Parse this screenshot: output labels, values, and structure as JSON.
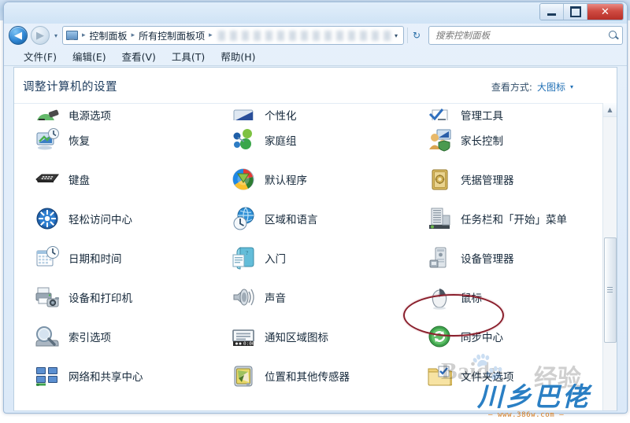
{
  "window": {
    "titlebar_buttons": [
      {
        "name": "minimize",
        "glyph": "—"
      },
      {
        "name": "maximize",
        "glyph": "□"
      },
      {
        "name": "close",
        "glyph": "✕"
      }
    ]
  },
  "address": {
    "back_glyph": "◀",
    "forward_glyph": "▶",
    "history_caret": "▾",
    "crumb_icon": "control-panel-icon",
    "breadcrumbs": [
      "控制面板",
      "所有控制面板项"
    ],
    "separator": "▸",
    "dropdown_caret": "▾",
    "refresh_glyph": "↻"
  },
  "search": {
    "placeholder": "搜索控制面板",
    "value": "",
    "icon": "search-icon"
  },
  "menubar": {
    "items": [
      "文件(F)",
      "编辑(E)",
      "查看(V)",
      "工具(T)",
      "帮助(H)"
    ]
  },
  "pane": {
    "title": "调整计算机的设置",
    "view_by_label": "查看方式:",
    "view_by_value": "大图标",
    "view_by_caret": "▾"
  },
  "scrollbar": {
    "up_arrow": "▲",
    "down_arrow": "▼"
  },
  "grid": {
    "rows": [
      {
        "clipped": true,
        "cells": [
          {
            "label": "电源选项",
            "icon": "power-options-icon"
          },
          {
            "label": "个性化",
            "icon": "personalization-icon"
          },
          {
            "label": "管理工具",
            "icon": "administrative-tools-icon"
          }
        ]
      },
      {
        "clipped": false,
        "cells": [
          {
            "label": "恢复",
            "icon": "recovery-icon"
          },
          {
            "label": "家庭组",
            "icon": "homegroup-icon"
          },
          {
            "label": "家长控制",
            "icon": "parental-controls-icon"
          }
        ]
      },
      {
        "clipped": false,
        "cells": [
          {
            "label": "键盘",
            "icon": "keyboard-icon"
          },
          {
            "label": "默认程序",
            "icon": "default-programs-icon"
          },
          {
            "label": "凭据管理器",
            "icon": "credential-manager-icon"
          }
        ]
      },
      {
        "clipped": false,
        "cells": [
          {
            "label": "轻松访问中心",
            "icon": "ease-of-access-icon"
          },
          {
            "label": "区域和语言",
            "icon": "region-and-language-icon"
          },
          {
            "label": "任务栏和「开始」菜单",
            "icon": "taskbar-start-menu-icon"
          }
        ]
      },
      {
        "clipped": false,
        "cells": [
          {
            "label": "日期和时间",
            "icon": "date-and-time-icon"
          },
          {
            "label": "入门",
            "icon": "getting-started-icon"
          },
          {
            "label": "设备管理器",
            "icon": "device-manager-icon"
          }
        ]
      },
      {
        "clipped": false,
        "cells": [
          {
            "label": "设备和打印机",
            "icon": "devices-and-printers-icon"
          },
          {
            "label": "声音",
            "icon": "sound-icon"
          },
          {
            "label": "鼠标",
            "icon": "mouse-icon"
          }
        ]
      },
      {
        "clipped": false,
        "cells": [
          {
            "label": "索引选项",
            "icon": "indexing-options-icon"
          },
          {
            "label": "通知区域图标",
            "icon": "notification-area-icons-icon"
          },
          {
            "label": "同步中心",
            "icon": "sync-center-icon"
          }
        ]
      },
      {
        "clipped": false,
        "cells": [
          {
            "label": "网络和共享中心",
            "icon": "network-sharing-center-icon"
          },
          {
            "label": "位置和其他传感器",
            "icon": "location-and-other-sensors-icon"
          },
          {
            "label": "文件夹选项",
            "icon": "folder-options-icon"
          }
        ]
      }
    ]
  },
  "annotation": {
    "highlight_target": "鼠标",
    "highlight_color": "#8a1f2c",
    "shape": "ellipse"
  },
  "watermarks": {
    "baidu_brand": "Baidu",
    "baidu_suffix": "经验",
    "site_name": "川乡巴佬",
    "site_url": "— www.386w.com —"
  },
  "colors": {
    "accent_link": "#1f6fb5",
    "title_text": "#1b3a5c",
    "close_button": "#b62f28",
    "highlight": "#8a1f2c"
  }
}
